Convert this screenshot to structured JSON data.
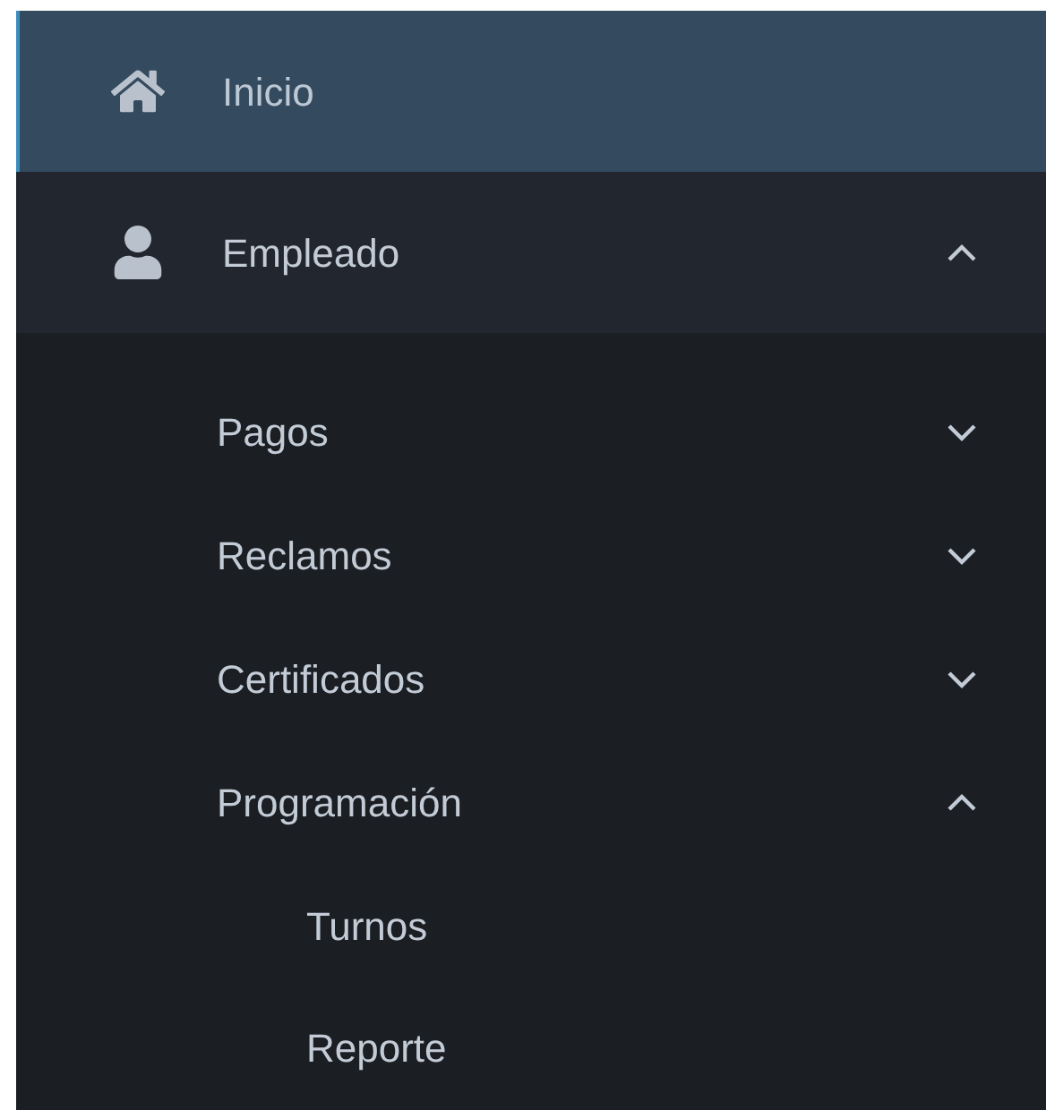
{
  "menu": [
    {
      "label": "Inicio",
      "selected": true
    },
    {
      "label": "Empleado",
      "selected": false,
      "expanded": true,
      "children": [
        {
          "label": "Pagos",
          "expanded": false
        },
        {
          "label": "Reclamos",
          "expanded": false
        },
        {
          "label": "Certificados",
          "expanded": false
        },
        {
          "label": "Programación",
          "expanded": true,
          "children": [
            {
              "label": "Turnos"
            },
            {
              "label": "Reporte"
            }
          ]
        }
      ]
    }
  ]
}
